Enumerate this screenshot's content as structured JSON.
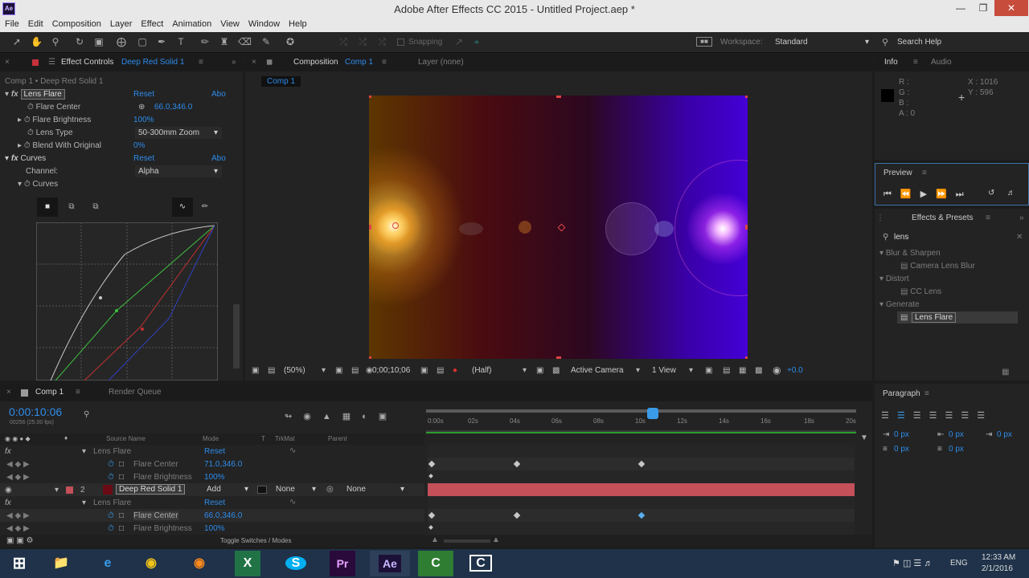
{
  "window": {
    "title": "Adobe After Effects CC 2015 - Untitled Project.aep *",
    "app_icon": "Ae"
  },
  "menu": [
    "File",
    "Edit",
    "Composition",
    "Layer",
    "Effect",
    "Animation",
    "View",
    "Window",
    "Help"
  ],
  "toolbar": {
    "snapping": "Snapping",
    "workspace_label": "Workspace:",
    "workspace_value": "Standard",
    "search_help": "Search Help"
  },
  "effect_controls": {
    "tab_label": "Effect Controls",
    "tab_layer": "Deep Red Solid 1",
    "breadcrumb": "Comp 1 • Deep Red Solid 1",
    "lens_flare": {
      "name": "Lens Flare",
      "reset": "Reset",
      "about": "Abo",
      "flare_center_label": "Flare Center",
      "flare_center_value": "66.0,346.0",
      "flare_brightness_label": "Flare Brightness",
      "flare_brightness_value": "100%",
      "lens_type_label": "Lens Type",
      "lens_type_value": "50-300mm Zoom",
      "blend_label": "Blend With Original",
      "blend_value": "0%"
    },
    "curves": {
      "name": "Curves",
      "reset": "Reset",
      "about": "Abo",
      "channel_label": "Channel:",
      "channel_value": "Alpha",
      "curves_label": "Curves"
    }
  },
  "composition": {
    "tab_label": "Composition",
    "tab_comp": "Comp 1",
    "layer_tab": "Layer (none)",
    "breadcrumb_comp": "Comp 1",
    "zoom": "(50%)",
    "timecode": "0;00;10;06",
    "resolution": "(Half)",
    "camera": "Active Camera",
    "view": "1 View",
    "exposure": "+0.0"
  },
  "info": {
    "tab_info": "Info",
    "tab_audio": "Audio",
    "r": "R :",
    "g": "G :",
    "b": "B :",
    "a": "A : 0",
    "x": "X : 1016",
    "y": "Y : 596"
  },
  "preview": {
    "title": "Preview"
  },
  "effects_presets": {
    "title": "Effects & Presets",
    "search": "lens",
    "groups": [
      {
        "name": "Blur & Sharpen",
        "item": "Camera Lens Blur"
      },
      {
        "name": "Distort",
        "item": "CC Lens"
      },
      {
        "name": "Generate",
        "item": "Lens Flare"
      }
    ]
  },
  "paragraph": {
    "title": "Paragraph",
    "px": "0 px"
  },
  "timeline": {
    "tab_comp": "Comp 1",
    "tab_render": "Render Queue",
    "timecode": "0:00:10:06",
    "fps": "00256 (25.00 fps)",
    "col_source": "Source Name",
    "col_mode": "Mode",
    "col_t": "T",
    "col_trkmat": "TrkMat",
    "col_parent": "Parent",
    "ruler": [
      "0:00s",
      "02s",
      "04s",
      "06s",
      "08s",
      "10s",
      "12s",
      "14s",
      "16s",
      "18s",
      "20s"
    ],
    "rows": [
      {
        "label": "Lens Flare",
        "value": "Reset"
      },
      {
        "label": "Flare Center",
        "value": "71.0,346.0"
      },
      {
        "label": "Flare Brightness",
        "value": "100%"
      },
      {
        "num": "2",
        "label": "Deep Red Solid 1",
        "mode": "Add",
        "trkmat": "None",
        "parent": "None"
      },
      {
        "label": "Lens Flare",
        "value": "Reset"
      },
      {
        "label": "Flare Center",
        "value": "66.0,346.0"
      },
      {
        "label": "Flare Brightness",
        "value": "100%"
      }
    ],
    "footer": "Toggle Switches / Modes"
  },
  "taskbar": {
    "lang": "ENG",
    "time": "12:33 AM",
    "date": "2/1/2016",
    "apps": [
      "Explorer",
      "IE",
      "Chrome",
      "Firefox",
      "Excel",
      "Skype",
      "Pr",
      "Ae",
      "Camtasia",
      "Camtasia2"
    ]
  }
}
